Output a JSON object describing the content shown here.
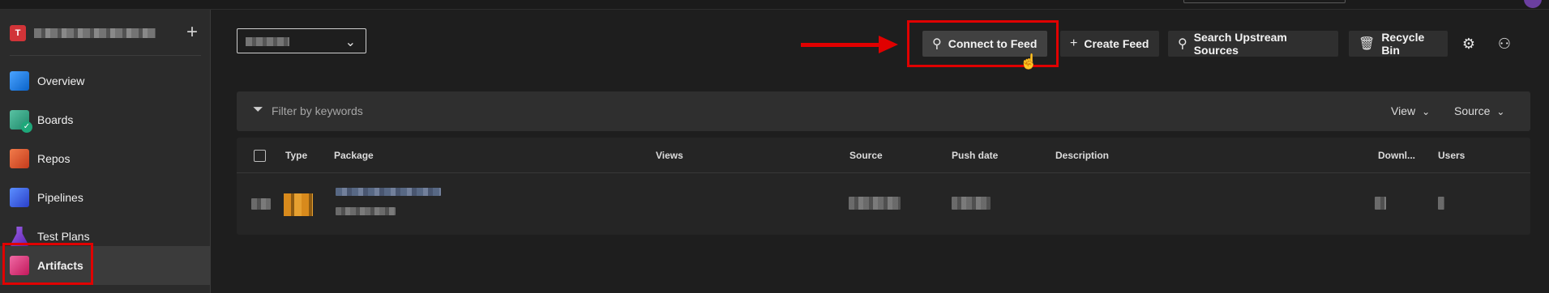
{
  "sidebar": {
    "project_initial": "T",
    "add_symbol": "+",
    "items": [
      {
        "label": "Overview",
        "icon": "overview-icon"
      },
      {
        "label": "Boards",
        "icon": "boards-icon"
      },
      {
        "label": "Repos",
        "icon": "repos-icon"
      },
      {
        "label": "Pipelines",
        "icon": "pipelines-icon"
      },
      {
        "label": "Test Plans",
        "icon": "test-plans-icon"
      },
      {
        "label": "Artifacts",
        "icon": "artifacts-icon",
        "active": true
      }
    ]
  },
  "toolbar": {
    "connect_label": "Connect to Feed",
    "create_label": "Create Feed",
    "search_label": "Search Upstream Sources",
    "recycle_label": "Recycle Bin"
  },
  "filter": {
    "placeholder": "Filter by keywords",
    "view_label": "View",
    "source_label": "Source"
  },
  "table": {
    "columns": [
      "Type",
      "Package",
      "Views",
      "Source",
      "Push date",
      "Description",
      "Downl...",
      "Users"
    ]
  },
  "colors": {
    "highlight": "#e00000",
    "background": "#1e1e1e",
    "sidebar": "#2b2b2b"
  }
}
